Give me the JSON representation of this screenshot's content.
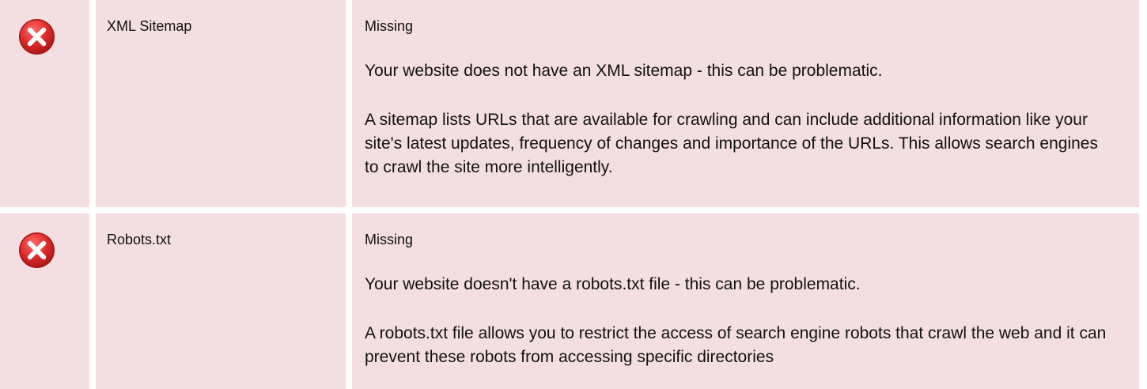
{
  "colors": {
    "row_background": "#f3dfe1",
    "error_icon": "#dd2b2b"
  },
  "icons": {
    "status": "error-x-circle-icon"
  },
  "checks": [
    {
      "label": "XML Sitemap",
      "status": "Missing",
      "summary": "Your website does not have an XML sitemap - this can be problematic.",
      "explanation": "A sitemap lists URLs that are available for crawling and can include additional information like your site's latest updates, frequency of changes and importance of the URLs. This allows search engines to crawl the site more intelligently."
    },
    {
      "label": "Robots.txt",
      "status": "Missing",
      "summary": "Your website doesn't have a robots.txt file - this can be problematic.",
      "explanation": "A robots.txt file allows you to restrict the access of search engine robots that crawl the web and it can prevent these robots from accessing specific directories"
    }
  ]
}
